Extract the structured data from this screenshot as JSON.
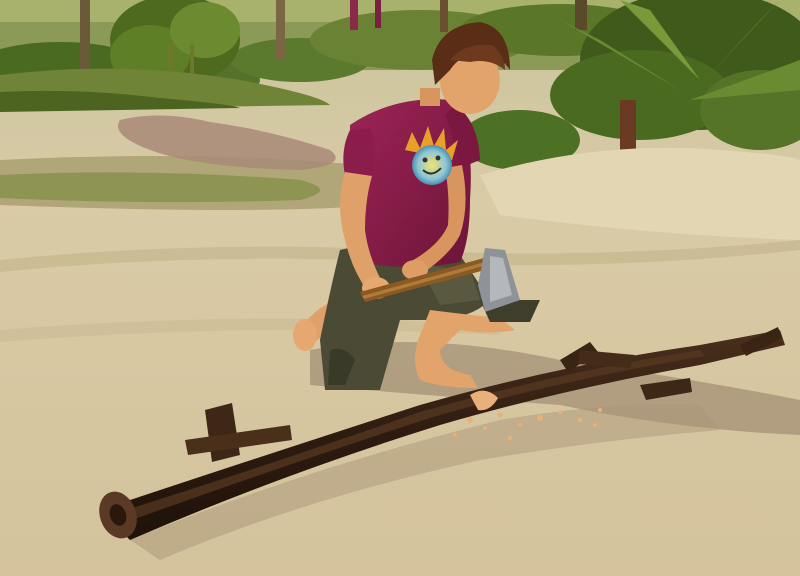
{
  "scene": {
    "setting": "tropical-island-beach",
    "character": "sim-teen-boy",
    "action": "chopping-log-with-axe"
  },
  "colors": {
    "sand": "#d6c6a0",
    "sand_dark": "#b9a47c",
    "grass": "#7f8c3e",
    "foliage": "#4f6a24",
    "shirt": "#8a1d4a",
    "skin": "#e8a56a",
    "hair": "#5a2d16",
    "shorts": "#4b4a34",
    "log_bark": "#3a2416",
    "axe_handle": "#8a5a22",
    "axe_blade": "#8f9296"
  },
  "icons": [
    "sun-smiley-shirt-graphic"
  ]
}
